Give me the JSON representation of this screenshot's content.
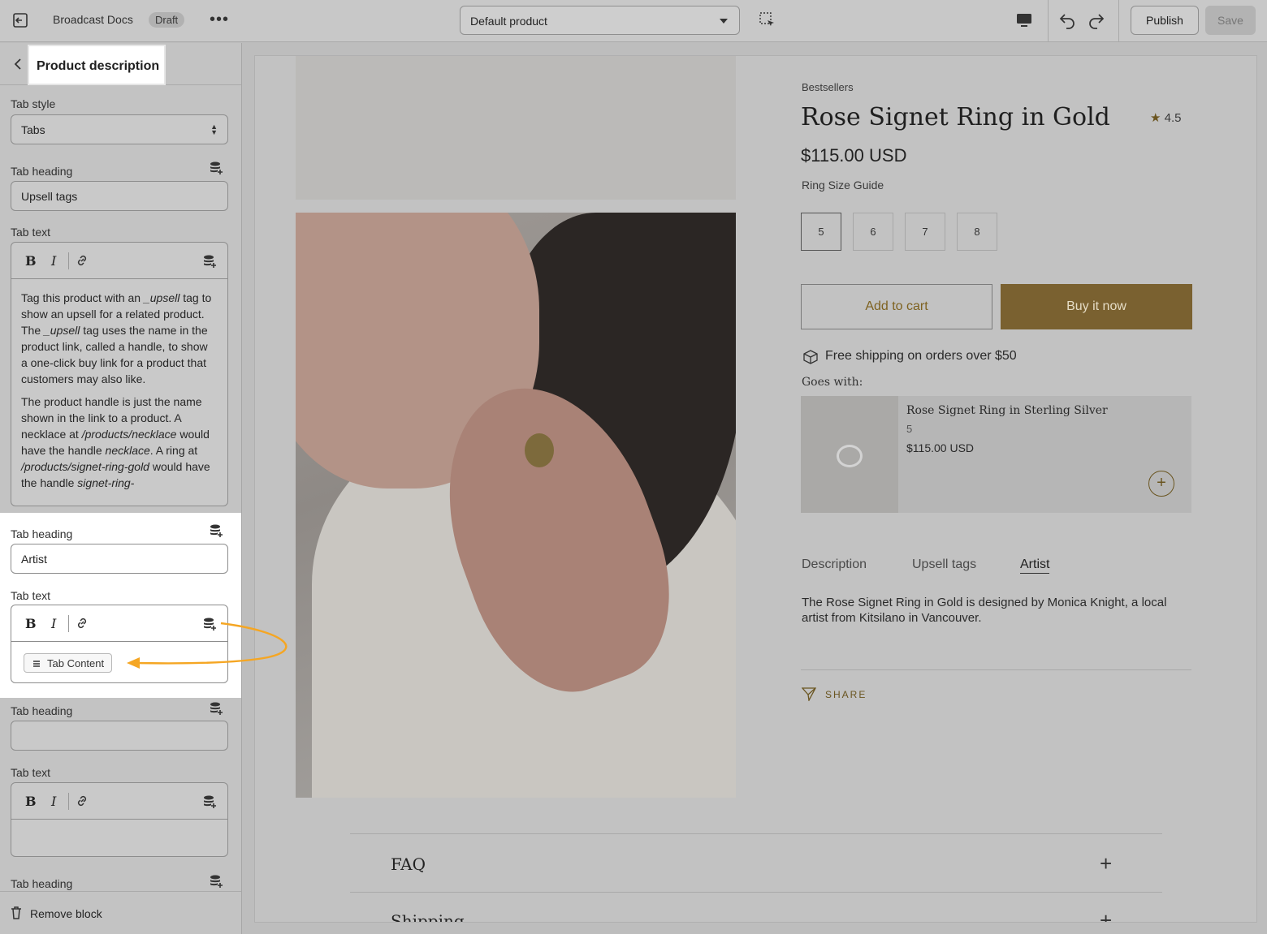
{
  "topbar": {
    "store_name": "Broadcast Docs",
    "status_badge": "Draft",
    "more_label": "•••",
    "template_select": "Default product",
    "publish_label": "Publish",
    "save_label": "Save"
  },
  "sidebar": {
    "title": "Product description",
    "tab_style_label": "Tab style",
    "tab_style_value": "Tabs",
    "blocks": [
      {
        "heading_label": "Tab heading",
        "heading_value": "Upsell tags",
        "text_label": "Tab text",
        "paragraphs": [
          [
            "Tag this product with an ",
            "_upsell",
            " tag to show an upsell for a related product. The ",
            "_upsell",
            " tag uses the name in the product link, called a handle, to show a one-click buy link for a product that customers may also like."
          ],
          [
            "The product handle is just the name shown in the link to a product. A necklace at ",
            "/products/necklace",
            " would have the handle ",
            "necklace",
            ". A ring at ",
            "/products/signet-ring-gold",
            " would have the handle ",
            "signet-ring-",
            ""
          ]
        ]
      },
      {
        "heading_label": "Tab heading",
        "heading_value": "Artist",
        "text_label": "Tab text",
        "dynamic_chip": "Tab Content"
      },
      {
        "heading_label": "Tab heading",
        "heading_value": "",
        "text_label": "Tab text"
      },
      {
        "heading_label": "Tab heading"
      }
    ],
    "toolbar": {
      "bold": "B",
      "italic": "I"
    },
    "remove_label": "Remove block"
  },
  "preview": {
    "vendor": "Bestsellers",
    "title": "Rose Signet Ring in Gold",
    "rating_star": "★",
    "rating": "4.5",
    "price": "$115.00 USD",
    "size_guide": "Ring Size Guide",
    "sizes": [
      "5",
      "6",
      "7",
      "8"
    ],
    "add_to_cart": "Add to cart",
    "buy_now": "Buy it now",
    "shipping_note": "Free shipping on orders over $50",
    "goes_with": "Goes with:",
    "upsell": {
      "name": "Rose Signet Ring in Sterling Silver",
      "variant": "5",
      "price": "$115.00 USD",
      "add": "+"
    },
    "tabs": [
      "Description",
      "Upsell tags",
      "Artist"
    ],
    "active_tab": "Artist",
    "tab_content": "The Rose Signet Ring in Gold is designed by Monica Knight, a local artist from Kitsilano in Vancouver.",
    "share": "SHARE",
    "faq": "FAQ",
    "shipping": "Shipping",
    "plus": "+"
  },
  "colors": {
    "accent": "#7a6130",
    "highlight": "#ffffff",
    "arrow": "#f5a623"
  }
}
